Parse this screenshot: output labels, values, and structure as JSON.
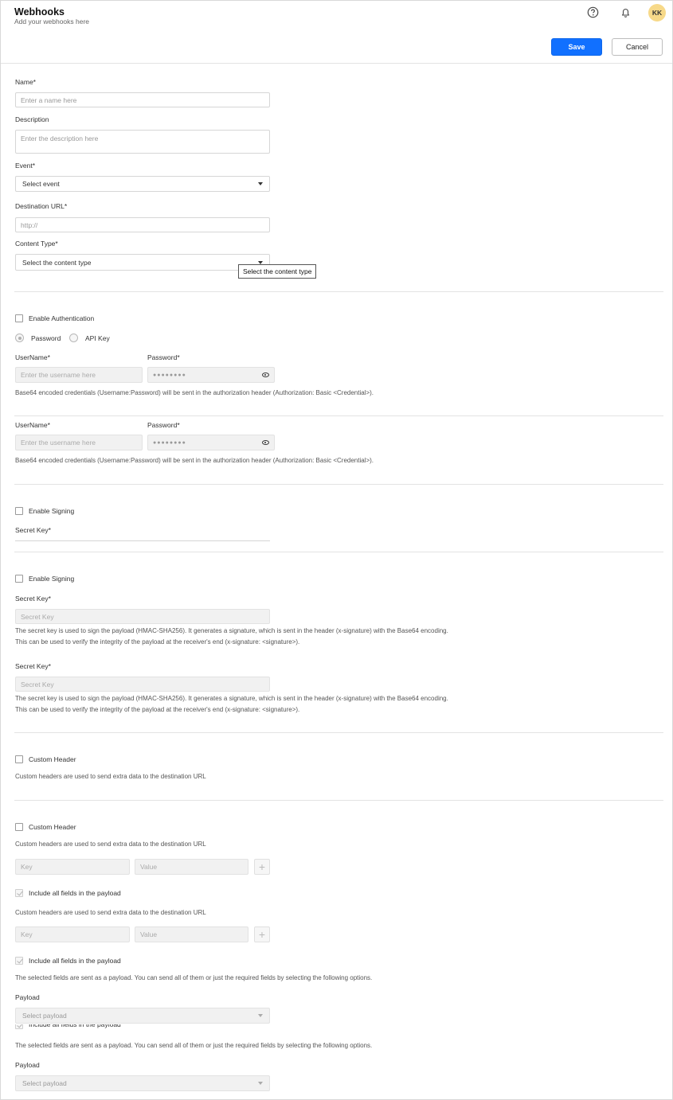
{
  "header": {
    "title": "Webhooks",
    "subtitle": "Add your webhooks here",
    "avatar_initials": "KK",
    "save_label": "Save",
    "cancel_label": "Cancel"
  },
  "colors": {
    "primary": "#1170ff",
    "avatar": "#f7d989",
    "divider": "#e3e3e3"
  },
  "icons": {
    "help": "help-circle-icon",
    "notifications": "bell-icon",
    "password_toggle": "eye-icon",
    "add": "plus-icon",
    "dropdown": "caret-down-icon"
  },
  "form": {
    "name_label": "Name*",
    "name_placeholder": "Enter a name here",
    "description_label": "Description",
    "description_placeholder": "Enter the description here",
    "event_label": "Event*",
    "event_value": "Select event",
    "url_label": "Destination URL*",
    "url_placeholder": "http://",
    "content_type_label": "Content Type*",
    "content_type_value": "Select the content type",
    "content_type_tooltip": "Select the content type"
  },
  "auth": {
    "enable_label": "Enable Authentication",
    "radio_password": "Password",
    "radio_api_key": "API Key",
    "username_label": "UserName*",
    "username_placeholder": "Enter the username here",
    "password_label": "Password*",
    "password_mask": "●●●●●●●●",
    "help": "Base64 encoded credentials (Username:Password) will be sent in the authorization header (Authorization: Basic <Credential>)."
  },
  "signing": {
    "enable_label": "Enable Signing",
    "secret_label": "Secret Key*",
    "secret_placeholder": "Secret Key",
    "help_line1": "The secret key is used to sign the payload (HMAC-SHA256). It generates a signature, which is sent in the header (x-signature) with the Base64 encoding.",
    "help_line2": "This can be used to verify the integrity of the payload at the receiver's end (x-signature: <signature>)."
  },
  "custom_header": {
    "label": "Custom Header",
    "help": "Custom headers are used to send extra data to the destination URL",
    "key_placeholder": "Key",
    "value_placeholder": "Value",
    "add_symbol": "+"
  },
  "payload": {
    "include_all_label": "Include all fields in the payload",
    "help": "The selected fields are sent as a payload. You can send all of them or just the required fields by selecting the following options.",
    "label": "Payload",
    "select_value": "Select payload"
  }
}
